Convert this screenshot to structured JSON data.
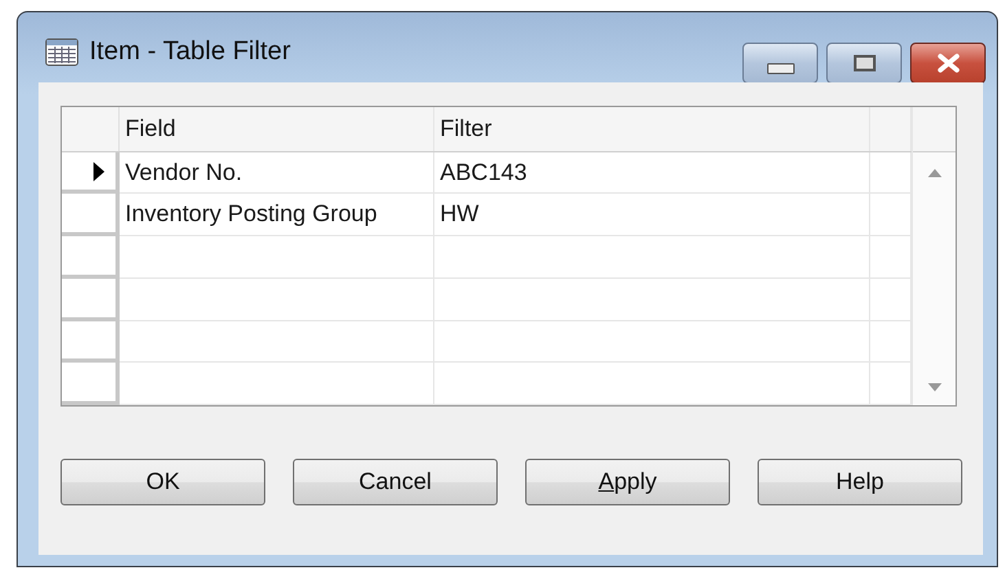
{
  "window": {
    "title": "Item - Table Filter"
  },
  "table": {
    "columns": [
      "Field",
      "Filter"
    ],
    "rows": [
      {
        "field": "Vendor No.",
        "filter": "ABC143",
        "selected": true
      },
      {
        "field": "Inventory Posting Group",
        "filter": "HW",
        "selected": false
      },
      {
        "selected": false
      },
      {
        "selected": false
      },
      {
        "selected": false
      },
      {
        "selected": false
      }
    ]
  },
  "buttons": [
    {
      "label": "OK",
      "underline_first": false
    },
    {
      "label": "Cancel",
      "underline_first": false
    },
    {
      "label": "Apply",
      "underline_first": true
    },
    {
      "label": "Help",
      "underline_first": false
    }
  ]
}
